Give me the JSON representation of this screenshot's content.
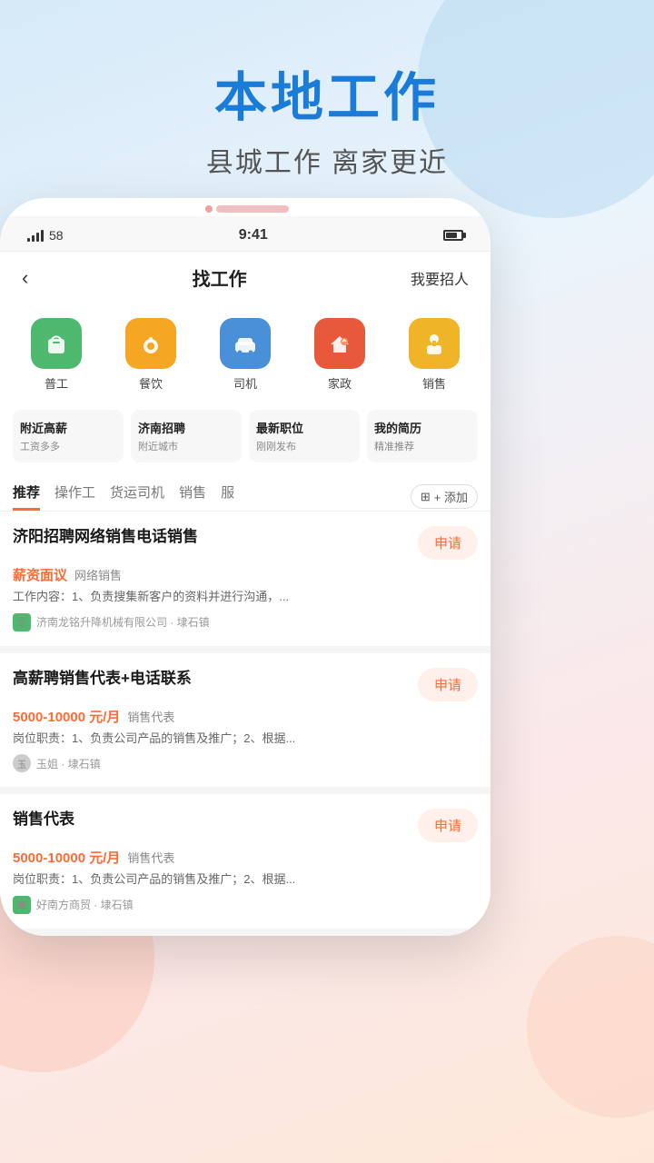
{
  "background": {
    "gradient_start": "#d6eaf8",
    "gradient_end": "#fde8d8"
  },
  "app_header": {
    "title": "本地工作",
    "subtitle": "县城工作  离家更近"
  },
  "status_bar": {
    "signal_label": "58",
    "time": "9:41",
    "battery_pct": 75
  },
  "nav": {
    "back_icon": "‹",
    "title": "找工作",
    "right_text": "我要招人"
  },
  "categories": [
    {
      "id": "general-worker",
      "label": "普工",
      "emoji": "👕",
      "color_class": "cat-green"
    },
    {
      "id": "catering",
      "label": "餐饮",
      "emoji": "🍽",
      "color_class": "cat-yellow"
    },
    {
      "id": "driver",
      "label": "司机",
      "emoji": "🚗",
      "color_class": "cat-blue"
    },
    {
      "id": "housekeeping",
      "label": "家政",
      "emoji": "🏠",
      "color_class": "cat-orange"
    },
    {
      "id": "sales",
      "label": "销售",
      "emoji": "👔",
      "color_class": "cat-gold"
    }
  ],
  "quick_links": [
    {
      "title": "附近高薪",
      "subtitle": "工资多多"
    },
    {
      "title": "济南招聘",
      "subtitle": "附近城市"
    },
    {
      "title": "最新职位",
      "subtitle": "刚刚发布"
    },
    {
      "title": "我的简历",
      "subtitle": "精准推荐"
    }
  ],
  "tabs": [
    {
      "label": "推荐",
      "active": true
    },
    {
      "label": "操作工",
      "active": false
    },
    {
      "label": "货运司机",
      "active": false
    },
    {
      "label": "销售",
      "active": false
    },
    {
      "label": "服",
      "active": false
    }
  ],
  "tab_add_label": "+ 添加",
  "jobs": [
    {
      "id": "job1",
      "title": "济阳招聘网络销售电话销售",
      "salary": "薪资面议",
      "salary_tag": "网络销售",
      "description": "工作内容：1、负责搜集新客户的资料并进行沟通，...",
      "company": "济南龙铭升降机械有限公司 · 埭石镇",
      "apply_label": "申请",
      "logo_type": "green-logo",
      "logo_text": "龙"
    },
    {
      "id": "job2",
      "title": "高薪聘销售代表+电话联系",
      "salary": "5000-10000 元/月",
      "salary_tag": "销售代表",
      "description": "岗位职责：1、负责公司产品的销售及推广；2、根据...",
      "company": "玉姐 · 埭石镇",
      "apply_label": "申请",
      "logo_type": "avatar-logo",
      "logo_text": "玉"
    },
    {
      "id": "job3",
      "title": "销售代表",
      "salary": "5000-10000 元/月",
      "salary_tag": "销售代表",
      "description": "岗位职责：1、负责公司产品的销售及推广；2、根据...",
      "company": "好南方商贸 · 埭石镇",
      "apply_label": "申请",
      "logo_type": "green-logo",
      "logo_text": "南"
    }
  ]
}
